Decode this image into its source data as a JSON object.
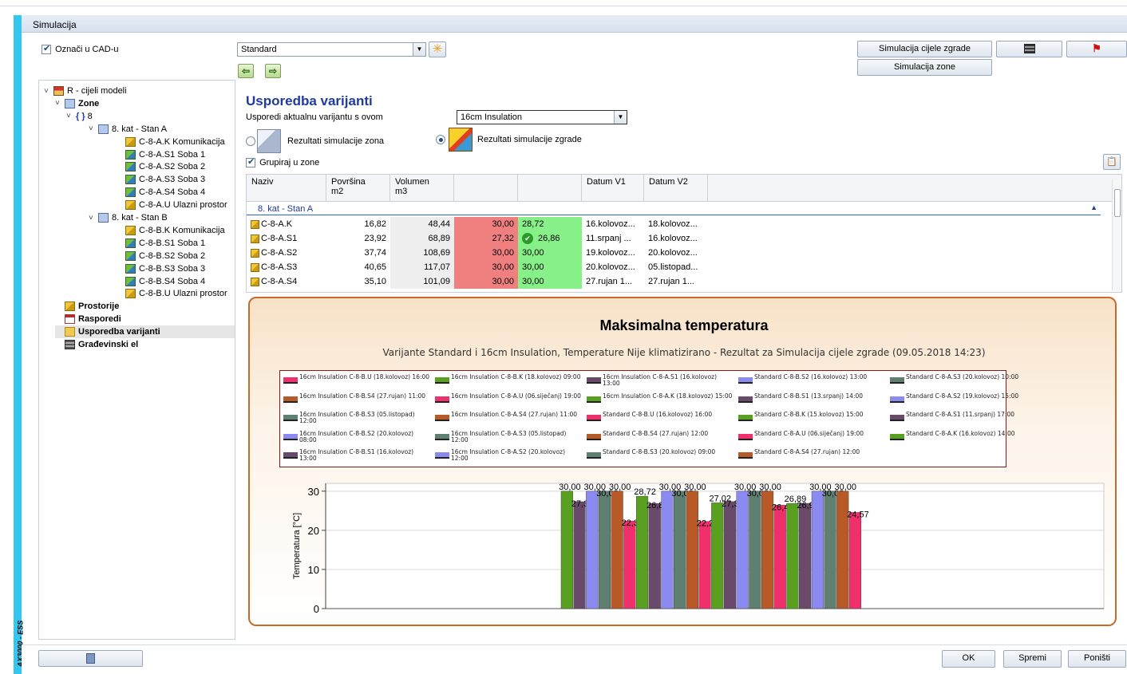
{
  "app": {
    "title": "Simulacija",
    "vertical_label": "AX3000 - ESS"
  },
  "left": {
    "cad_checkbox_label": "Označi u CAD-u",
    "tree": [
      {
        "label": "R - cijeli modeli",
        "level": 0,
        "icon": "house-icon",
        "arrow": "˅",
        "bold": false
      },
      {
        "label": "Zone",
        "level": 1,
        "icon": "zone-icon",
        "arrow": "˅",
        "bold": true
      },
      {
        "label": "8",
        "level": 2,
        "icon": "braces-icon",
        "arrow": "˅",
        "bold": false
      },
      {
        "label": "8. kat - Stan A",
        "level": 3,
        "icon": "zone-icon",
        "arrow": "˅",
        "bold": false
      },
      {
        "label": "C-8-A.K Komunikacija",
        "level": 4,
        "icon": "room-icon",
        "arrow": "",
        "bold": false
      },
      {
        "label": "C-8-A.S1 Soba 1",
        "level": 4,
        "icon": "room-heated-icon",
        "arrow": "",
        "bold": false
      },
      {
        "label": "C-8-A.S2 Soba 2",
        "level": 4,
        "icon": "room-heated-icon",
        "arrow": "",
        "bold": false
      },
      {
        "label": "C-8-A.S3 Soba 3",
        "level": 4,
        "icon": "room-heated-icon",
        "arrow": "",
        "bold": false
      },
      {
        "label": "C-8-A.S4 Soba 4",
        "level": 4,
        "icon": "room-heated-icon",
        "arrow": "",
        "bold": false
      },
      {
        "label": "C-8-A.U Ulazni prostor",
        "level": 4,
        "icon": "room-icon",
        "arrow": "",
        "bold": false
      },
      {
        "label": "8. kat - Stan B",
        "level": 3,
        "icon": "zone-icon",
        "arrow": "˅",
        "bold": false
      },
      {
        "label": "C-8-B.K Komunikacija",
        "level": 4,
        "icon": "room-icon",
        "arrow": "",
        "bold": false
      },
      {
        "label": "C-8-B.S1 Soba 1",
        "level": 4,
        "icon": "room-heated-icon",
        "arrow": "",
        "bold": false
      },
      {
        "label": "C-8-B.S2 Soba 2",
        "level": 4,
        "icon": "room-heated-icon",
        "arrow": "",
        "bold": false
      },
      {
        "label": "C-8-B.S3 Soba 3",
        "level": 4,
        "icon": "room-heated-icon",
        "arrow": "",
        "bold": false
      },
      {
        "label": "C-8-B.S4 Soba 4",
        "level": 4,
        "icon": "room-heated-icon",
        "arrow": "",
        "bold": false
      },
      {
        "label": "C-8-B.U Ulazni prostor",
        "level": 4,
        "icon": "room-icon",
        "arrow": "",
        "bold": false
      },
      {
        "label": "Prostorije",
        "level": 1,
        "icon": "room-icon",
        "arrow": "",
        "bold": true
      },
      {
        "label": "Rasporedi",
        "level": 1,
        "icon": "schedule-icon",
        "arrow": "",
        "bold": true
      },
      {
        "label": "Usporedba varijanti",
        "level": 1,
        "icon": "compare-folder-icon",
        "arrow": "",
        "bold": true,
        "selected": true
      },
      {
        "label": "Građevinski el",
        "level": 1,
        "icon": "wall-icon",
        "arrow": "",
        "bold": true
      }
    ]
  },
  "toolbar": {
    "variant_select": "Standard",
    "sim_building_label": "Simulacija cijele zgrade",
    "sim_zone_label": "Simulacija zone"
  },
  "compare": {
    "title": "Usporedba varijanti",
    "compare_label": "Usporedi aktualnu varijantu s ovom",
    "compare_select": "16cm Insulation",
    "radio_zones": "Rezultati simulacije zona",
    "radio_building": "Rezultati simulacije zgrade",
    "group_label": "Grupiraj u zone"
  },
  "grid": {
    "headers": [
      {
        "l1": "Naziv",
        "l2": ""
      },
      {
        "l1": "Površina",
        "l2": "m2"
      },
      {
        "l1": "Volumen",
        "l2": "m3"
      },
      {
        "l1": "",
        "l2": ""
      },
      {
        "l1": "",
        "l2": ""
      },
      {
        "l1": "Datum V1",
        "l2": ""
      },
      {
        "l1": "Datum V2",
        "l2": ""
      }
    ],
    "group_label": "8. kat - Stan A",
    "rows": [
      {
        "name": "C-8-A.K",
        "area": "16,82",
        "vol": "48,44",
        "v1": "30,00",
        "v2": "28,72",
        "d1": "16.kolovoz...",
        "d2": "18.kolovoz...",
        "check": false
      },
      {
        "name": "C-8-A.S1",
        "area": "23,92",
        "vol": "68,89",
        "v1": "27,32",
        "v2": "26,86",
        "d1": "11.srpanj ...",
        "d2": "16.kolovoz...",
        "check": true
      },
      {
        "name": "C-8-A.S2",
        "area": "37,74",
        "vol": "108,69",
        "v1": "30,00",
        "v2": "30,00",
        "d1": "19.kolovoz...",
        "d2": "20.kolovoz...",
        "check": false
      },
      {
        "name": "C-8-A.S3",
        "area": "40,65",
        "vol": "117,07",
        "v1": "30,00",
        "v2": "30,00",
        "d1": "20.kolovoz...",
        "d2": "05.listopad...",
        "check": false
      },
      {
        "name": "C-8-A.S4",
        "area": "35,10",
        "vol": "101,09",
        "v1": "30,00",
        "v2": "30,00",
        "d1": "27.rujan 1...",
        "d2": "27.rujan 1...",
        "check": false
      }
    ]
  },
  "chart": {
    "title": "Maksimalna temperatura",
    "subtitle": "Varijante Standard i 16cm Insulation, Temperature Nije klimatizirano - Rezultat za Simulacija cijele zgrade (09.05.2018 14:23)",
    "legend": [
      {
        "text": "16cm Insulation C-8-B.U (18.kolovoz) 16:00",
        "color": "#f0306a"
      },
      {
        "text": "16cm Insulation C-8-B.S4 (27.rujan) 11:00",
        "color": "#b85a28"
      },
      {
        "text": "16cm Insulation C-8-B.S3 (05.listopad) 12:00",
        "color": "#5f8070"
      },
      {
        "text": "16cm Insulation C-8-B.S2 (20.kolovoz) 08:00",
        "color": "#8a8af0"
      },
      {
        "text": "16cm Insulation C-8-B.S1 (16.kolovoz) 13:00",
        "color": "#6a4a6a"
      },
      {
        "text": "16cm Insulation C-8-B.K (18.kolovoz) 09:00",
        "color": "#5aa020"
      },
      {
        "text": "16cm Insulation C-8-A.U (06.siječanj) 19:00",
        "color": "#f0306a"
      },
      {
        "text": "16cm Insulation C-8-A.S4 (27.rujan) 11:00",
        "color": "#b85a28"
      },
      {
        "text": "16cm Insulation C-8-A.S3 (05.listopad) 12:00",
        "color": "#5f8070"
      },
      {
        "text": "16cm Insulation C-8-A.S2 (20.kolovoz) 12:00",
        "color": "#8a8af0"
      },
      {
        "text": "16cm Insulation C-8-A.S1 (16.kolovoz) 13:00",
        "color": "#6a4a6a"
      },
      {
        "text": "16cm Insulation C-8-A.K (18.kolovoz) 15:00",
        "color": "#5aa020"
      },
      {
        "text": "Standard C-8-B.U (16.kolovoz) 16:00",
        "color": "#f0306a"
      },
      {
        "text": "Standard C-8-B.S4 (27.rujan) 12:00",
        "color": "#b85a28"
      },
      {
        "text": "Standard C-8-B.S3 (20.kolovoz) 09:00",
        "color": "#5f8070"
      },
      {
        "text": "Standard C-8-B.S2 (16.kolovoz) 13:00",
        "color": "#8a8af0"
      },
      {
        "text": "Standard C-8-B.S1 (13.srpanj) 14:00",
        "color": "#6a4a6a"
      },
      {
        "text": "Standard C-8-B.K (15.kolovoz) 15:00",
        "color": "#5aa020"
      },
      {
        "text": "Standard C-8-A.U (06.siječanj) 19:00",
        "color": "#f0306a"
      },
      {
        "text": "Standard C-8-A.S4 (27.rujan) 12:00",
        "color": "#b85a28"
      },
      {
        "text": "Standard C-8-A.S3 (20.kolovoz) 10:00",
        "color": "#5f8070"
      },
      {
        "text": "Standard C-8-A.S2 (19.kolovoz) 15:00",
        "color": "#8a8af0"
      },
      {
        "text": "Standard C-8-A.S1 (11.srpanj) 17:00",
        "color": "#6a4a6a"
      },
      {
        "text": "Standard C-8-A.K (16.kolovoz) 14:00",
        "color": "#5aa020"
      }
    ]
  },
  "chart_data": {
    "type": "bar",
    "title": "Maksimalna temperatura",
    "ylabel": "Temperatura [°C]",
    "ylim": [
      0,
      32
    ],
    "yticks": [
      0,
      10,
      20,
      30
    ],
    "grid": true,
    "legend_position": "top",
    "bars": [
      {
        "value": 30.0,
        "label": "30,00",
        "color": "#5aa020"
      },
      {
        "value": 27.32,
        "label": "27,32",
        "color": "#6a4a6a"
      },
      {
        "value": 30.0,
        "label": "30,00",
        "color": "#8a8af0"
      },
      {
        "value": 30.0,
        "label": "30,00",
        "color": "#5f8070"
      },
      {
        "value": 30.0,
        "label": "30,00",
        "color": "#b85a28"
      },
      {
        "value": 22.37,
        "label": "22,37",
        "color": "#f0306a"
      },
      {
        "value": 28.72,
        "label": "28,72",
        "color": "#5aa020"
      },
      {
        "value": 26.86,
        "label": "26,86",
        "color": "#6a4a6a"
      },
      {
        "value": 30.0,
        "label": "30,00",
        "color": "#8a8af0"
      },
      {
        "value": 30.0,
        "label": "30,00",
        "color": "#5f8070"
      },
      {
        "value": 30.0,
        "label": "30,00",
        "color": "#b85a28"
      },
      {
        "value": 22.27,
        "label": "22,27",
        "color": "#f0306a"
      },
      {
        "value": 27.02,
        "label": "27,02",
        "color": "#5aa020"
      },
      {
        "value": 27.34,
        "label": "27,34",
        "color": "#6a4a6a"
      },
      {
        "value": 30.0,
        "label": "30,00",
        "color": "#8a8af0"
      },
      {
        "value": 30.0,
        "label": "30,00",
        "color": "#5f8070"
      },
      {
        "value": 30.0,
        "label": "30,00",
        "color": "#b85a28"
      },
      {
        "value": 26.42,
        "label": "26,42",
        "color": "#f0306a"
      },
      {
        "value": 26.89,
        "label": "26,89",
        "color": "#5aa020"
      },
      {
        "value": 26.9,
        "label": "26,90",
        "color": "#6a4a6a"
      },
      {
        "value": 30.0,
        "label": "30,00",
        "color": "#8a8af0"
      },
      {
        "value": 30.0,
        "label": "30,00",
        "color": "#5f8070"
      },
      {
        "value": 30.0,
        "label": "30,00",
        "color": "#b85a28"
      },
      {
        "value": 24.57,
        "label": "24,57",
        "color": "#f0306a"
      }
    ]
  },
  "footer": {
    "ok_label": "OK",
    "save_label": "Spremi",
    "cancel_label": "Poništi"
  }
}
